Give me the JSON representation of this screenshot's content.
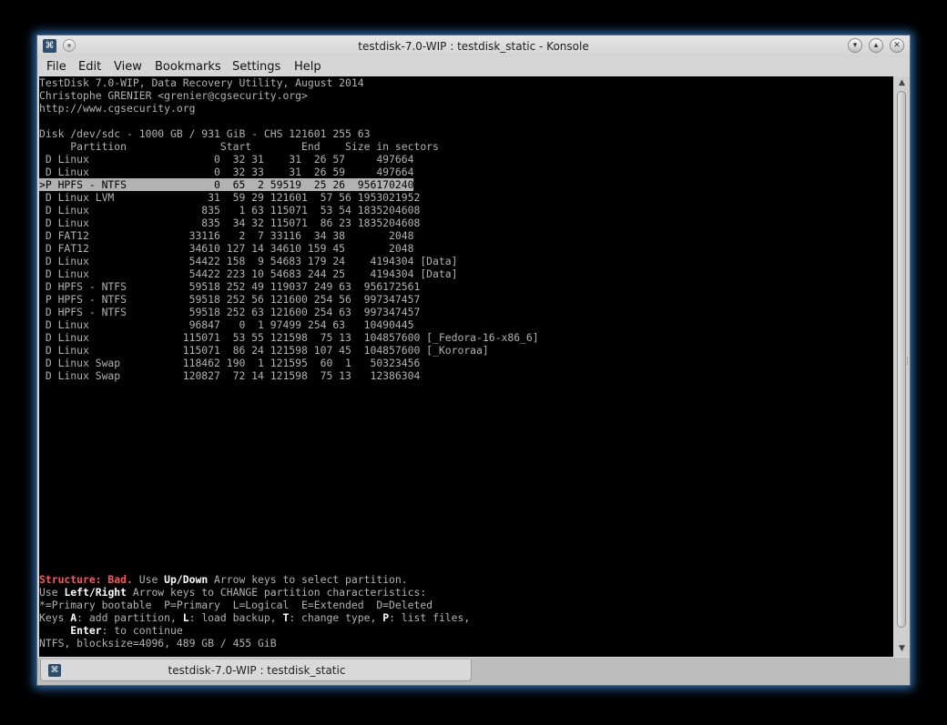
{
  "window": {
    "title": "testdisk-7.0-WIP : testdisk_static - Konsole",
    "icons": {
      "app": "konsole-icon",
      "pin": "pin-icon",
      "minimize": "chevron-down-icon",
      "maximize": "chevron-up-icon",
      "close": "close-icon"
    }
  },
  "menu": {
    "file": "File",
    "edit": "Edit",
    "view": "View",
    "bookmarks": "Bookmarks",
    "settings": "Settings",
    "help": "Help"
  },
  "terminal": {
    "header": [
      "TestDisk 7.0-WIP, Data Recovery Utility, August 2014",
      "Christophe GRENIER <grenier@cgsecurity.org>",
      "http://www.cgsecurity.org"
    ],
    "disk_info": "Disk /dev/sdc - 1000 GB / 931 GiB - CHS 121601 255 63",
    "column_header": "     Partition               Start        End    Size in sectors",
    "partitions": [
      " D Linux                    0  32 31    31  26 57     497664",
      " D Linux                    0  32 33    31  26 59     497664",
      ">P HPFS - NTFS              0  65  2 59519  25 26  956170240",
      " D Linux LVM               31  59 29 121601  57 56 1953021952",
      " D Linux                  835   1 63 115071  53 54 1835204608",
      " D Linux                  835  34 32 115071  86 23 1835204608",
      " D FAT12                33116   2  7 33116  34 38       2048",
      " D FAT12                34610 127 14 34610 159 45       2048",
      " D Linux                54422 158  9 54683 179 24    4194304 [Data]",
      " D Linux                54422 223 10 54683 244 25    4194304 [Data]",
      " D HPFS - NTFS          59518 252 49 119037 249 63  956172561",
      " P HPFS - NTFS          59518 252 56 121600 254 56  997347457",
      " D HPFS - NTFS          59518 252 63 121600 254 63  997347457",
      " D Linux                96847   0  1 97499 254 63   10490445",
      " D Linux               115071  53 55 121598  75 13  104857600 [_Fedora-16-x86_6]",
      " D Linux               115071  86 24 121598 107 45  104857600 [_Kororaa]",
      " D Linux Swap          118462 190  1 121595  60  1   50323456",
      " D Linux Swap          120827  72 14 121598  75 13   12386304"
    ],
    "selected_index": 2,
    "footer": {
      "line1": {
        "structure": "Structure: Bad.",
        "use": " Use ",
        "updown": "Up/Down",
        "rest": " Arrow keys to select partition."
      },
      "line2": {
        "use": "Use ",
        "leftright": "Left/Right",
        "rest": " Arrow keys to CHANGE partition characteristics:"
      },
      "line3": "*=Primary bootable  P=Primary  L=Logical  E=Extended  D=Deleted",
      "line4": {
        "p1": "Keys ",
        "k1": "A",
        "p2": ": add partition, ",
        "k2": "L",
        "p3": ": load backup, ",
        "k3": "T",
        "p4": ": change type, ",
        "k4": "P",
        "p5": ": list files,"
      },
      "line5": {
        "indent": "     ",
        "key": "Enter",
        "rest": ": to continue"
      },
      "line6": "NTFS, blocksize=4096, 489 GB / 455 GiB"
    }
  },
  "tab": {
    "label": "testdisk-7.0-WIP : testdisk_static"
  }
}
